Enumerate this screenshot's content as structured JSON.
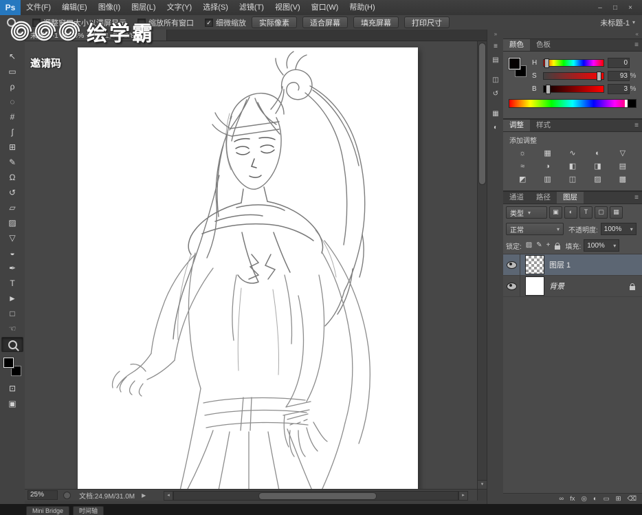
{
  "colors": {
    "ps_logo_blue": "#2678bf",
    "panel_background": "#505050",
    "canvas_background": "#474747",
    "selected_layer_row": "#5c6673",
    "page_white": "#ffffff"
  },
  "icons": {
    "caret": "▾",
    "menu": "≡",
    "collapse": "«",
    "flyout": "▶",
    "scroll_down": "▾",
    "scroll_left": "◂",
    "scroll_right": "▸"
  },
  "titlebar": {
    "logo": "Ps",
    "menus": [
      "文件(F)",
      "编辑(E)",
      "图像(I)",
      "图层(L)",
      "文字(Y)",
      "选择(S)",
      "滤镜(T)",
      "视图(V)",
      "窗口(W)",
      "帮助(H)"
    ],
    "window_controls": {
      "minimize": "–",
      "maximize": "□",
      "close": "×"
    }
  },
  "options_bar": {
    "checkboxes": [
      {
        "label": "调整窗口大小以满屏显示",
        "mark": ""
      },
      {
        "label": "缩放所有窗口",
        "mark": ""
      },
      {
        "label": "细微缩放",
        "mark": "✓"
      }
    ],
    "buttons": [
      "实际像素",
      "适合屏幕",
      "填充屏幕",
      "打印尺寸"
    ],
    "workspace": "未标题-1"
  },
  "toolbar": {
    "collapse_glyph": "«",
    "tools": [
      {
        "name": "移动工具",
        "glyph": "↖"
      },
      {
        "name": "矩形选框工具",
        "glyph": "▭"
      },
      {
        "name": "套索工具",
        "glyph": "ρ"
      },
      {
        "name": "快速选择工具",
        "glyph": "◌"
      },
      {
        "name": "裁剪工具",
        "glyph": "#"
      },
      {
        "name": "吸管工具",
        "glyph": "ʃ"
      },
      {
        "name": "污点修复画笔工具",
        "glyph": "⊞"
      },
      {
        "name": "画笔工具",
        "glyph": "✎"
      },
      {
        "name": "仿制图章工具",
        "glyph": "Ω"
      },
      {
        "name": "历史记录画笔工具",
        "glyph": "↺"
      },
      {
        "name": "橡皮擦工具",
        "glyph": "▱"
      },
      {
        "name": "渐变工具",
        "glyph": "▨"
      },
      {
        "name": "模糊工具",
        "glyph": "▽"
      },
      {
        "name": "减淡工具",
        "glyph": "◒"
      },
      {
        "name": "钢笔工具",
        "glyph": "✒"
      },
      {
        "name": "横排文字工具",
        "glyph": "T"
      },
      {
        "name": "路径选择工具",
        "glyph": "►"
      },
      {
        "name": "矩形工具",
        "glyph": "□"
      },
      {
        "name": "抓手工具",
        "glyph": "☜"
      },
      {
        "name": "缩放工具",
        "glyph": ""
      }
    ],
    "extras": [
      {
        "name": "以快速蒙版模式编辑",
        "glyph": "⊡"
      },
      {
        "name": "更改屏幕模式",
        "glyph": "▣"
      }
    ]
  },
  "document": {
    "tab_title": "未标题-1 @ 25% (图层 1, RGB/8)",
    "zoom": "25%",
    "doc_info": "文档:24.9M/31.0M"
  },
  "watermark": {
    "brand": "绘学霸",
    "caption": "邀请码"
  },
  "dock_strip": {
    "expand": "»",
    "icons": [
      "≡",
      "▤",
      "◫",
      "↺",
      "▦",
      "◐"
    ]
  },
  "panels": {
    "color": {
      "tabs": [
        "颜色",
        "色板"
      ],
      "sliders": [
        {
          "label": "H",
          "value": "0",
          "unit": ""
        },
        {
          "label": "S",
          "value": "93",
          "unit": "%"
        },
        {
          "label": "B",
          "value": "3",
          "unit": "%"
        }
      ]
    },
    "adjustments": {
      "tabs": [
        "调整",
        "样式"
      ],
      "title": "添加调整",
      "icons": [
        "☼",
        "▦",
        "∿",
        "◐",
        "▽",
        "≈",
        "◑",
        "◧",
        "◨",
        "▤",
        "◩",
        "▥",
        "◫",
        "▨",
        "▩"
      ]
    },
    "layers": {
      "tabs": [
        "通道",
        "路径",
        "图层"
      ],
      "filter_label": "类型",
      "filter_icons": [
        "▣",
        "◐",
        "T",
        "▢",
        "▦"
      ],
      "blend_mode": "正常",
      "opacity_label": "不透明度:",
      "opacity": "100%",
      "lock_label": "锁定:",
      "lock_icons": [
        "▨",
        "✎",
        "+"
      ],
      "fill_label": "填充:",
      "fill": "100%",
      "rows": [
        {
          "name": "图层 1",
          "selected": true
        },
        {
          "name": "背景",
          "selected": false
        }
      ],
      "bottom_icons": [
        "∞",
        "fx",
        "◎",
        "◐",
        "▭",
        "⊞",
        "⌫"
      ]
    }
  },
  "bottom_bar": {
    "buttons": [
      "Mini Bridge",
      "时间轴"
    ]
  }
}
